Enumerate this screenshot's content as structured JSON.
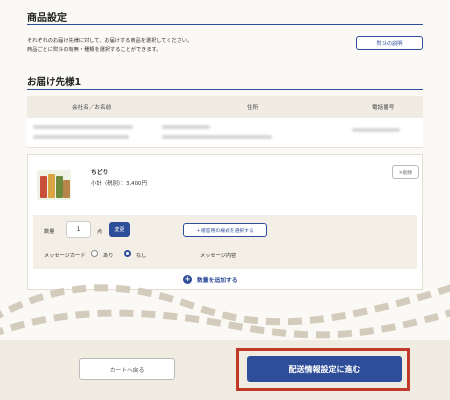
{
  "header": {
    "title": "商品設定",
    "description_lines": [
      "それぞれのお届け先様に対して、お届けする商品を選択してください。",
      "商品ごとに熨斗の有無・種類を選択することができます。"
    ],
    "noshi_button": "熨斗の説明"
  },
  "recipient": {
    "title": "お届け先様1",
    "columns": [
      "会社名／お名前",
      "住所",
      "電話番号"
    ]
  },
  "item": {
    "name": "ちどり",
    "price": "小計（税別）：3,400円",
    "delete_label": "×削除",
    "qty_label": "数量",
    "qty_value": "1",
    "qty_unit": "点",
    "change_label": "変更",
    "recipient_form_button": "＋贈答用の様式を選択する",
    "message_card_label": "メッセージカード",
    "option_yes": "あり",
    "option_no": "なし",
    "message_content_label": "メッセージ内容",
    "add_qty_label": "数量を追加する"
  },
  "footer": {
    "back_label": "カートへ戻る",
    "next_label": "配送情報設定に進む"
  },
  "colors": {
    "accent": "#2f4e9a",
    "highlight": "#c0392b",
    "background": "#fbf9f5"
  }
}
